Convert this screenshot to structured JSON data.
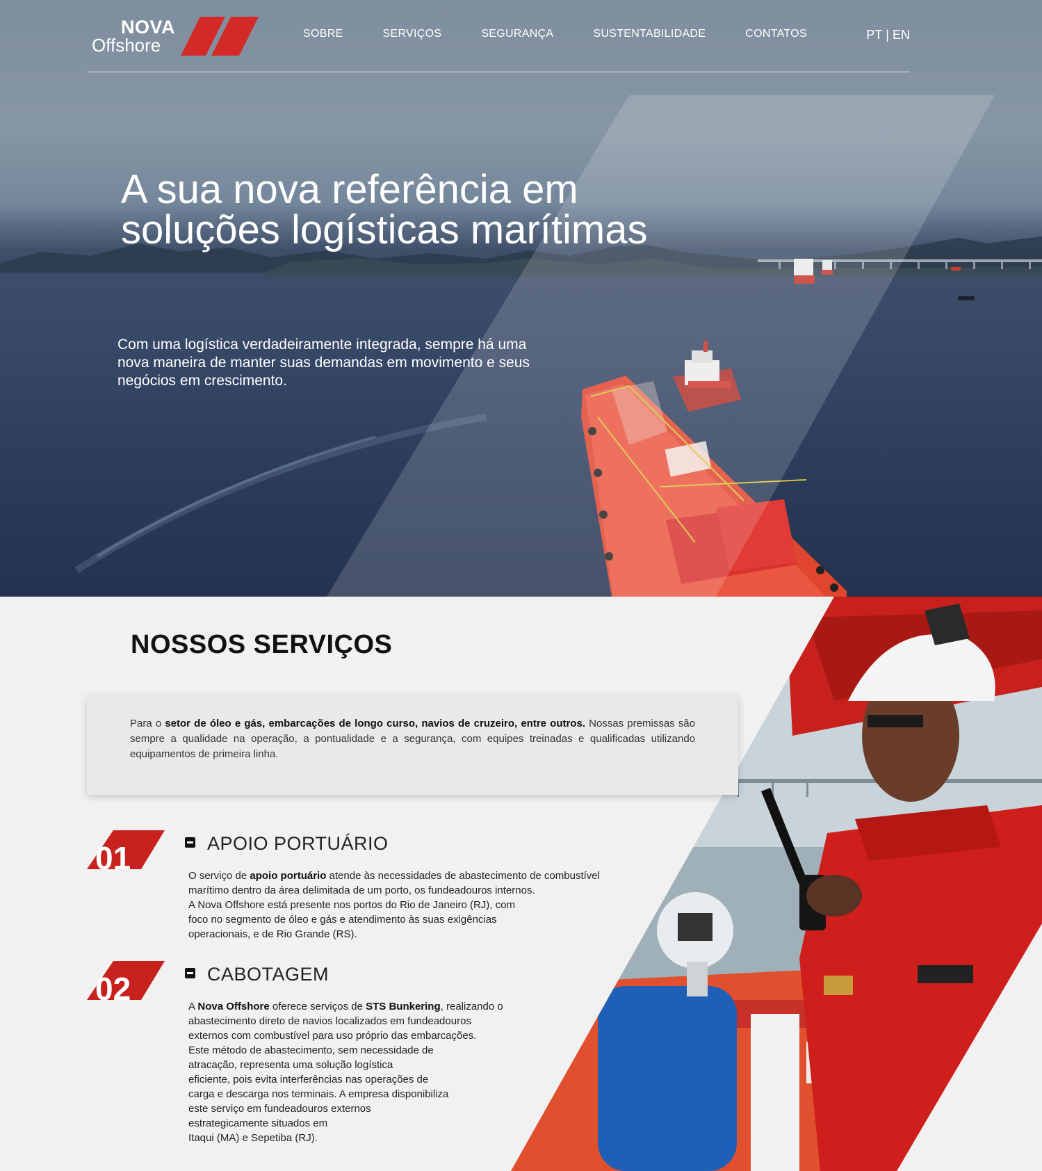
{
  "brand": {
    "name_top": "NOVA",
    "name_bottom": "Offshore",
    "accent_color": "#d42a27"
  },
  "nav": {
    "items": [
      "SOBRE",
      "SERVIÇOS",
      "SEGURANÇA",
      "SUSTENTABILIDADE",
      "CONTATOS"
    ],
    "lang_pt": "PT",
    "lang_sep": "|",
    "lang_en": "EN"
  },
  "hero": {
    "title": "A sua nova referência em soluções logísticas marítimas",
    "subtitle": "Com uma logística verdadeiramente integrada, sempre há uma nova maneira de manter suas demandas em movimento e seus negócios em crescimento."
  },
  "services": {
    "heading": "NOSSOS SERVIÇOS",
    "intro": {
      "prefix": "Para o ",
      "bold": "setor de óleo e gás, embarcações de longo curso, navios de cruzeiro, entre outros.",
      "rest": " Nossas premissas são sempre a qualidade na operação, a pontualidade e a segurança, com equipes treinadas e qualificadas utilizando equipamentos de primeira linha."
    },
    "items": [
      {
        "number": "01",
        "title": "APOIO PORTUÁRIO",
        "lines": [
          [
            "O serviço de ",
            "apoio portuário",
            " atende às necessidades de abastecimento de combustível"
          ],
          [
            "marítimo dentro da área delimitada de um porto, os fundeadouros internos."
          ],
          [
            "A Nova Offshore está presente nos portos do Rio de Janeiro (RJ), com"
          ],
          [
            "foco no segmento de óleo e gás e atendimento às suas exigências"
          ],
          [
            "operacionais, e de Rio Grande (RS)."
          ]
        ]
      },
      {
        "number": "02",
        "title": "CABOTAGEM",
        "lines": [
          [
            "A ",
            "Nova Offshore",
            " oferece serviços de ",
            "STS Bunkering",
            ", realizando o"
          ],
          [
            "abastecimento direto de navios localizados em fundeadouros"
          ],
          [
            "externos com combustível para uso próprio das embarcações."
          ],
          [
            "Este método de abastecimento, sem necessidade de"
          ],
          [
            "atracação, representa uma solução logística"
          ],
          [
            "eficiente, pois evita interferências nas operações de"
          ],
          [
            "carga e descarga nos terminais. A empresa disponibiliza"
          ],
          [
            "este serviço em fundeadouros externos"
          ],
          [
            "estrategicamente situados em"
          ],
          [
            "Itaqui (MA) e Sepetiba (RJ)."
          ]
        ]
      }
    ]
  }
}
